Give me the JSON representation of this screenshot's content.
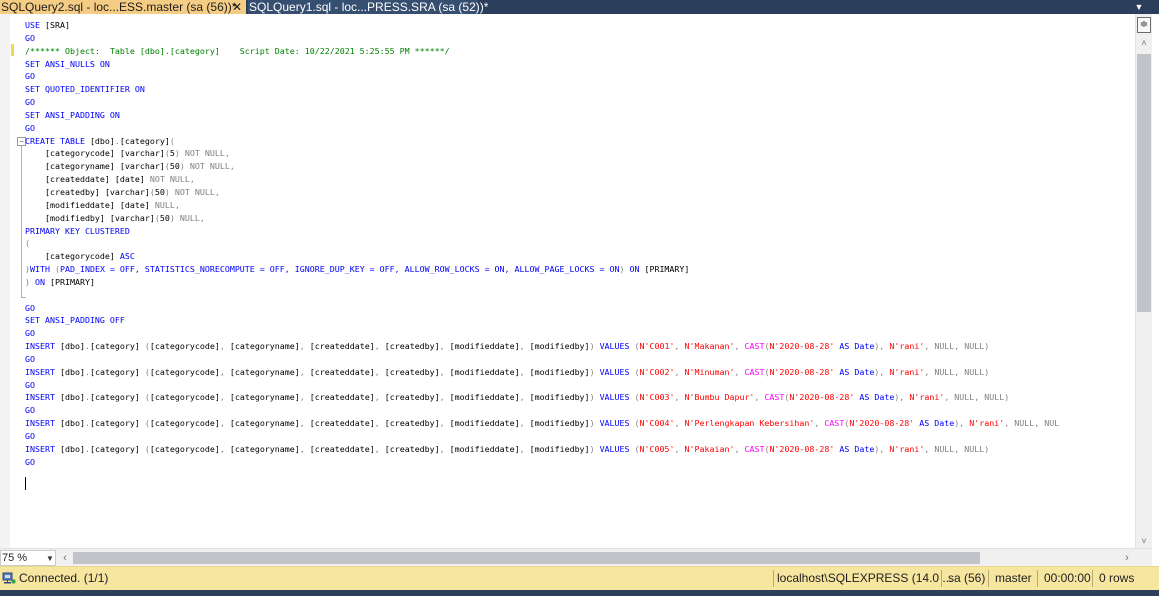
{
  "tabs": [
    {
      "label": "SQLQuery2.sql - loc...ESS.master (sa (56))*",
      "active": true,
      "close": "✕"
    },
    {
      "label": "SQLQuery1.sql - loc...PRESS.SRA (sa (52))*",
      "active": false
    }
  ],
  "tab_menu_icon": "chevron-down-icon",
  "editor": {
    "language": "T-SQL",
    "lines": [
      [
        {
          "t": "USE ",
          "c": "kw"
        },
        {
          "t": "[SRA]",
          "c": ""
        }
      ],
      [
        {
          "t": "GO",
          "c": "kw"
        }
      ],
      [
        {
          "t": "/****** Object:  Table [dbo].[category]    Script Date: 10/22/2021 5:25:55 PM ******/",
          "c": "cm"
        }
      ],
      [
        {
          "t": "SET ANSI_NULLS ON",
          "c": "kw"
        }
      ],
      [
        {
          "t": "GO",
          "c": "kw"
        }
      ],
      [
        {
          "t": "SET QUOTED_IDENTIFIER ON",
          "c": "kw"
        }
      ],
      [
        {
          "t": "GO",
          "c": "kw"
        }
      ],
      [
        {
          "t": "SET ANSI_PADDING ON",
          "c": "kw"
        }
      ],
      [
        {
          "t": "GO",
          "c": "kw"
        }
      ],
      [
        {
          "t": "CREATE TABLE ",
          "c": "kw"
        },
        {
          "t": "[dbo]",
          "c": ""
        },
        {
          "t": ".",
          "c": "gy"
        },
        {
          "t": "[category]",
          "c": ""
        },
        {
          "t": "(",
          "c": "gy"
        }
      ],
      [
        {
          "t": "    [categorycode] ",
          "c": ""
        },
        {
          "t": "[varchar]",
          "c": ""
        },
        {
          "t": "(",
          "c": "gy"
        },
        {
          "t": "5",
          "c": ""
        },
        {
          "t": ") NOT NULL,",
          "c": "gy"
        }
      ],
      [
        {
          "t": "    [categoryname] ",
          "c": ""
        },
        {
          "t": "[varchar]",
          "c": ""
        },
        {
          "t": "(",
          "c": "gy"
        },
        {
          "t": "50",
          "c": ""
        },
        {
          "t": ") NOT NULL,",
          "c": "gy"
        }
      ],
      [
        {
          "t": "    [createddate] ",
          "c": ""
        },
        {
          "t": "[date] ",
          "c": ""
        },
        {
          "t": "NOT NULL,",
          "c": "gy"
        }
      ],
      [
        {
          "t": "    [createdby] ",
          "c": ""
        },
        {
          "t": "[varchar]",
          "c": ""
        },
        {
          "t": "(",
          "c": "gy"
        },
        {
          "t": "50",
          "c": ""
        },
        {
          "t": ") NOT NULL,",
          "c": "gy"
        }
      ],
      [
        {
          "t": "    [modifieddate] ",
          "c": ""
        },
        {
          "t": "[date] ",
          "c": ""
        },
        {
          "t": "NULL,",
          "c": "gy"
        }
      ],
      [
        {
          "t": "    [modifiedby] ",
          "c": ""
        },
        {
          "t": "[varchar]",
          "c": ""
        },
        {
          "t": "(",
          "c": "gy"
        },
        {
          "t": "50",
          "c": ""
        },
        {
          "t": ") NULL,",
          "c": "gy"
        }
      ],
      [
        {
          "t": "PRIMARY KEY CLUSTERED",
          "c": "kw"
        }
      ],
      [
        {
          "t": "(",
          "c": "gy"
        }
      ],
      [
        {
          "t": "    [categorycode] ",
          "c": ""
        },
        {
          "t": "ASC",
          "c": "kw"
        }
      ],
      [
        {
          "t": ")",
          "c": "gy"
        },
        {
          "t": "WITH ",
          "c": "kw"
        },
        {
          "t": "(",
          "c": "gy"
        },
        {
          "t": "PAD_INDEX = OFF, STATISTICS_NORECOMPUTE = OFF, IGNORE_DUP_KEY = OFF, ALLOW_ROW_LOCKS = ON, ALLOW_PAGE_LOCKS = ON",
          "c": "kw"
        },
        {
          "t": ") ",
          "c": "gy"
        },
        {
          "t": "ON ",
          "c": "kw"
        },
        {
          "t": "[PRIMARY]",
          "c": ""
        }
      ],
      [
        {
          "t": ") ",
          "c": "gy"
        },
        {
          "t": "ON ",
          "c": "kw"
        },
        {
          "t": "[PRIMARY]",
          "c": ""
        }
      ],
      [
        {
          "t": "",
          "c": ""
        }
      ],
      [
        {
          "t": "GO",
          "c": "kw"
        }
      ],
      [
        {
          "t": "SET ANSI_PADDING OFF",
          "c": "kw"
        }
      ],
      [
        {
          "t": "GO",
          "c": "kw"
        }
      ],
      [
        {
          "t": "INSERT ",
          "c": "kw"
        },
        {
          "t": "[dbo]",
          "c": ""
        },
        {
          "t": ".",
          "c": "gy"
        },
        {
          "t": "[category] ",
          "c": ""
        },
        {
          "t": "(",
          "c": "gy"
        },
        {
          "t": "[categorycode]",
          "c": ""
        },
        {
          "t": ", ",
          "c": "gy"
        },
        {
          "t": "[categoryname]",
          "c": ""
        },
        {
          "t": ", ",
          "c": "gy"
        },
        {
          "t": "[createddate]",
          "c": ""
        },
        {
          "t": ", ",
          "c": "gy"
        },
        {
          "t": "[createdby]",
          "c": ""
        },
        {
          "t": ", ",
          "c": "gy"
        },
        {
          "t": "[modifieddate]",
          "c": ""
        },
        {
          "t": ", ",
          "c": "gy"
        },
        {
          "t": "[modifiedby]",
          "c": ""
        },
        {
          "t": ") ",
          "c": "gy"
        },
        {
          "t": "VALUES ",
          "c": "kw"
        },
        {
          "t": "(",
          "c": "gy"
        },
        {
          "t": "N'C001'",
          "c": "st"
        },
        {
          "t": ", ",
          "c": "gy"
        },
        {
          "t": "N'Makanan'",
          "c": "st"
        },
        {
          "t": ", ",
          "c": "gy"
        },
        {
          "t": "CAST",
          "c": "fn"
        },
        {
          "t": "(",
          "c": "gy"
        },
        {
          "t": "N'2020-08-28' ",
          "c": "st"
        },
        {
          "t": "AS ",
          "c": "kw"
        },
        {
          "t": "Date",
          "c": "kw"
        },
        {
          "t": "), ",
          "c": "gy"
        },
        {
          "t": "N'rani'",
          "c": "st"
        },
        {
          "t": ", NULL, NULL)",
          "c": "gy"
        }
      ],
      [
        {
          "t": "GO",
          "c": "kw"
        }
      ],
      [
        {
          "t": "INSERT ",
          "c": "kw"
        },
        {
          "t": "[dbo]",
          "c": ""
        },
        {
          "t": ".",
          "c": "gy"
        },
        {
          "t": "[category] ",
          "c": ""
        },
        {
          "t": "(",
          "c": "gy"
        },
        {
          "t": "[categorycode]",
          "c": ""
        },
        {
          "t": ", ",
          "c": "gy"
        },
        {
          "t": "[categoryname]",
          "c": ""
        },
        {
          "t": ", ",
          "c": "gy"
        },
        {
          "t": "[createddate]",
          "c": ""
        },
        {
          "t": ", ",
          "c": "gy"
        },
        {
          "t": "[createdby]",
          "c": ""
        },
        {
          "t": ", ",
          "c": "gy"
        },
        {
          "t": "[modifieddate]",
          "c": ""
        },
        {
          "t": ", ",
          "c": "gy"
        },
        {
          "t": "[modifiedby]",
          "c": ""
        },
        {
          "t": ") ",
          "c": "gy"
        },
        {
          "t": "VALUES ",
          "c": "kw"
        },
        {
          "t": "(",
          "c": "gy"
        },
        {
          "t": "N'C002'",
          "c": "st"
        },
        {
          "t": ", ",
          "c": "gy"
        },
        {
          "t": "N'Minuman'",
          "c": "st"
        },
        {
          "t": ", ",
          "c": "gy"
        },
        {
          "t": "CAST",
          "c": "fn"
        },
        {
          "t": "(",
          "c": "gy"
        },
        {
          "t": "N'2020-08-28' ",
          "c": "st"
        },
        {
          "t": "AS ",
          "c": "kw"
        },
        {
          "t": "Date",
          "c": "kw"
        },
        {
          "t": "), ",
          "c": "gy"
        },
        {
          "t": "N'rani'",
          "c": "st"
        },
        {
          "t": ", NULL, NULL)",
          "c": "gy"
        }
      ],
      [
        {
          "t": "GO",
          "c": "kw"
        }
      ],
      [
        {
          "t": "INSERT ",
          "c": "kw"
        },
        {
          "t": "[dbo]",
          "c": ""
        },
        {
          "t": ".",
          "c": "gy"
        },
        {
          "t": "[category] ",
          "c": ""
        },
        {
          "t": "(",
          "c": "gy"
        },
        {
          "t": "[categorycode]",
          "c": ""
        },
        {
          "t": ", ",
          "c": "gy"
        },
        {
          "t": "[categoryname]",
          "c": ""
        },
        {
          "t": ", ",
          "c": "gy"
        },
        {
          "t": "[createddate]",
          "c": ""
        },
        {
          "t": ", ",
          "c": "gy"
        },
        {
          "t": "[createdby]",
          "c": ""
        },
        {
          "t": ", ",
          "c": "gy"
        },
        {
          "t": "[modifieddate]",
          "c": ""
        },
        {
          "t": ", ",
          "c": "gy"
        },
        {
          "t": "[modifiedby]",
          "c": ""
        },
        {
          "t": ") ",
          "c": "gy"
        },
        {
          "t": "VALUES ",
          "c": "kw"
        },
        {
          "t": "(",
          "c": "gy"
        },
        {
          "t": "N'C003'",
          "c": "st"
        },
        {
          "t": ", ",
          "c": "gy"
        },
        {
          "t": "N'Bumbu Dapur'",
          "c": "st"
        },
        {
          "t": ", ",
          "c": "gy"
        },
        {
          "t": "CAST",
          "c": "fn"
        },
        {
          "t": "(",
          "c": "gy"
        },
        {
          "t": "N'2020-08-28' ",
          "c": "st"
        },
        {
          "t": "AS ",
          "c": "kw"
        },
        {
          "t": "Date",
          "c": "kw"
        },
        {
          "t": "), ",
          "c": "gy"
        },
        {
          "t": "N'rani'",
          "c": "st"
        },
        {
          "t": ", NULL, NULL)",
          "c": "gy"
        }
      ],
      [
        {
          "t": "GO",
          "c": "kw"
        }
      ],
      [
        {
          "t": "INSERT ",
          "c": "kw"
        },
        {
          "t": "[dbo]",
          "c": ""
        },
        {
          "t": ".",
          "c": "gy"
        },
        {
          "t": "[category] ",
          "c": ""
        },
        {
          "t": "(",
          "c": "gy"
        },
        {
          "t": "[categorycode]",
          "c": ""
        },
        {
          "t": ", ",
          "c": "gy"
        },
        {
          "t": "[categoryname]",
          "c": ""
        },
        {
          "t": ", ",
          "c": "gy"
        },
        {
          "t": "[createddate]",
          "c": ""
        },
        {
          "t": ", ",
          "c": "gy"
        },
        {
          "t": "[createdby]",
          "c": ""
        },
        {
          "t": ", ",
          "c": "gy"
        },
        {
          "t": "[modifieddate]",
          "c": ""
        },
        {
          "t": ", ",
          "c": "gy"
        },
        {
          "t": "[modifiedby]",
          "c": ""
        },
        {
          "t": ") ",
          "c": "gy"
        },
        {
          "t": "VALUES ",
          "c": "kw"
        },
        {
          "t": "(",
          "c": "gy"
        },
        {
          "t": "N'C004'",
          "c": "st"
        },
        {
          "t": ", ",
          "c": "gy"
        },
        {
          "t": "N'Perlengkapan Kebersihan'",
          "c": "st"
        },
        {
          "t": ", ",
          "c": "gy"
        },
        {
          "t": "CAST",
          "c": "fn"
        },
        {
          "t": "(",
          "c": "gy"
        },
        {
          "t": "N'2020-08-28' ",
          "c": "st"
        },
        {
          "t": "AS ",
          "c": "kw"
        },
        {
          "t": "Date",
          "c": "kw"
        },
        {
          "t": "), ",
          "c": "gy"
        },
        {
          "t": "N'rani'",
          "c": "st"
        },
        {
          "t": ", NULL, NUL",
          "c": "gy"
        }
      ],
      [
        {
          "t": "GO",
          "c": "kw"
        }
      ],
      [
        {
          "t": "INSERT ",
          "c": "kw"
        },
        {
          "t": "[dbo]",
          "c": ""
        },
        {
          "t": ".",
          "c": "gy"
        },
        {
          "t": "[category] ",
          "c": ""
        },
        {
          "t": "(",
          "c": "gy"
        },
        {
          "t": "[categorycode]",
          "c": ""
        },
        {
          "t": ", ",
          "c": "gy"
        },
        {
          "t": "[categoryname]",
          "c": ""
        },
        {
          "t": ", ",
          "c": "gy"
        },
        {
          "t": "[createddate]",
          "c": ""
        },
        {
          "t": ", ",
          "c": "gy"
        },
        {
          "t": "[createdby]",
          "c": ""
        },
        {
          "t": ", ",
          "c": "gy"
        },
        {
          "t": "[modifieddate]",
          "c": ""
        },
        {
          "t": ", ",
          "c": "gy"
        },
        {
          "t": "[modifiedby]",
          "c": ""
        },
        {
          "t": ") ",
          "c": "gy"
        },
        {
          "t": "VALUES ",
          "c": "kw"
        },
        {
          "t": "(",
          "c": "gy"
        },
        {
          "t": "N'C005'",
          "c": "st"
        },
        {
          "t": ", ",
          "c": "gy"
        },
        {
          "t": "N'Pakaian'",
          "c": "st"
        },
        {
          "t": ", ",
          "c": "gy"
        },
        {
          "t": "CAST",
          "c": "fn"
        },
        {
          "t": "(",
          "c": "gy"
        },
        {
          "t": "N'2020-08-28' ",
          "c": "st"
        },
        {
          "t": "AS ",
          "c": "kw"
        },
        {
          "t": "Date",
          "c": "kw"
        },
        {
          "t": "), ",
          "c": "gy"
        },
        {
          "t": "N'rani'",
          "c": "st"
        },
        {
          "t": ", NULL, NULL)",
          "c": "gy"
        }
      ],
      [
        {
          "t": "GO",
          "c": "kw"
        }
      ]
    ]
  },
  "scrollbar": {
    "split_icon": "split-view-icon",
    "up_icon": "up-arrow-icon",
    "down_icon": "down-arrow-icon",
    "left_icon": "left-arrow-icon",
    "right_icon": "right-arrow-icon"
  },
  "zoom": {
    "value": "75 %"
  },
  "status": {
    "icon": "connection-icon",
    "message": "Connected. (1/1)",
    "server": "localhost\\SQLEXPRESS (14.0 ...",
    "user": "sa (56)",
    "database": "master",
    "elapsed": "00:00:00",
    "rows": "0 rows"
  },
  "colors": {
    "tab_active": "#f5cc84",
    "tab_strip": "#2b3e5c",
    "status_bar": "#f7e6a0",
    "keyword": "#0000ff",
    "comment": "#008000",
    "string": "#ff0000",
    "function": "#ff00ff",
    "operator": "#808080"
  }
}
